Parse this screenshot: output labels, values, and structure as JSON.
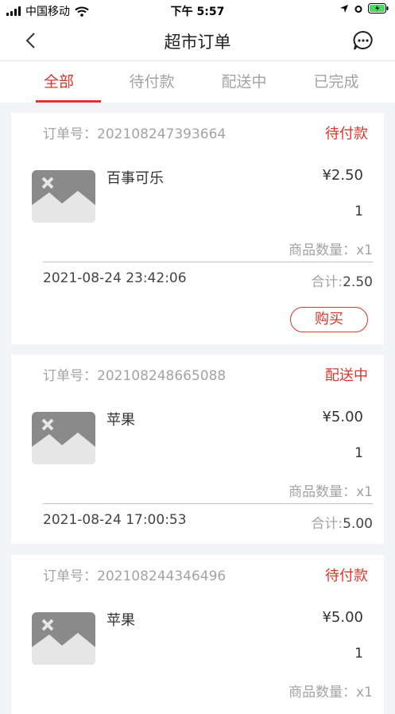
{
  "status_bar": {
    "carrier": "中国移动",
    "time": "下午 5:57"
  },
  "header": {
    "title": "超市订单"
  },
  "tabs": [
    {
      "label": "全部",
      "active": true
    },
    {
      "label": "待付款",
      "active": false
    },
    {
      "label": "配送中",
      "active": false
    },
    {
      "label": "已完成",
      "active": false
    }
  ],
  "orders": [
    {
      "order_no_label": "订单号：",
      "order_no": "202108247393664",
      "status": "待付款",
      "product_name": "百事可乐",
      "price": "¥2.50",
      "quantity": "1",
      "count_text": "商品数量：x1",
      "date": "2021-08-24 23:42:06",
      "total_label": "合计:",
      "total_value": "2.50",
      "action_label": "购买"
    },
    {
      "order_no_label": "订单号：",
      "order_no": "202108248665088",
      "status": "配送中",
      "product_name": "苹果",
      "price": "¥5.00",
      "quantity": "1",
      "count_text": "商品数量：x1",
      "date": "2021-08-24 17:00:53",
      "total_label": "合计:",
      "total_value": "5.00"
    },
    {
      "order_no_label": "订单号：",
      "order_no": "202108244346496",
      "status": "待付款",
      "product_name": "苹果",
      "price": "¥5.00",
      "quantity": "1",
      "count_text": "商品数量：x1"
    }
  ],
  "colors": {
    "accent": "#d8372b",
    "muted": "#a3a3a3",
    "background": "#f2f4f7"
  }
}
